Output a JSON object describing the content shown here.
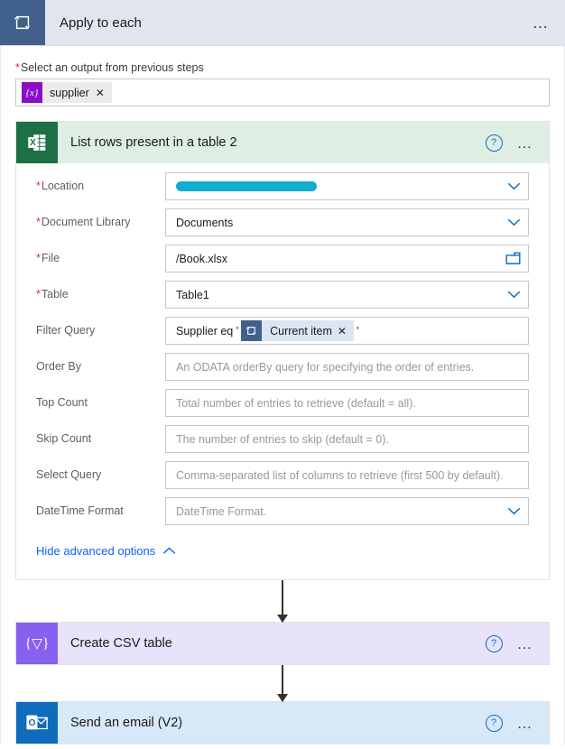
{
  "scope": {
    "title": "Apply to each",
    "icon": "loop-icon",
    "menu_label": "…",
    "input_label": "Select an output from previous steps",
    "required_marker": "*",
    "token": {
      "icon_glyph": "{x}",
      "label": "supplier",
      "remove_label": "✕"
    }
  },
  "excel_card": {
    "title": "List rows present in a table 2",
    "icon": "excel-icon",
    "help_label": "?",
    "menu_label": "…",
    "header_color": "#dfeee2",
    "icon_color": "#1d7044",
    "fields": [
      {
        "label": "Location",
        "required": true,
        "type": "dropdown",
        "value": "",
        "placeholder": "",
        "redacted": true
      },
      {
        "label": "Document Library",
        "required": true,
        "type": "dropdown",
        "value": "Documents",
        "placeholder": ""
      },
      {
        "label": "File",
        "required": true,
        "type": "filepicker",
        "value": "/Book.xlsx",
        "placeholder": ""
      },
      {
        "label": "Table",
        "required": true,
        "type": "dropdown",
        "value": "Table1",
        "placeholder": ""
      },
      {
        "label": "Filter Query",
        "required": false,
        "type": "tokenized",
        "prefix": "Supplier eq '",
        "suffix": "'",
        "token": {
          "icon_glyph": "loop-icon",
          "label": "Current item",
          "remove_label": "✕"
        }
      },
      {
        "label": "Order By",
        "required": false,
        "type": "text",
        "value": "",
        "placeholder": "An ODATA orderBy query for specifying the order of entries."
      },
      {
        "label": "Top Count",
        "required": false,
        "type": "text",
        "value": "",
        "placeholder": "Total number of entries to retrieve (default = all)."
      },
      {
        "label": "Skip Count",
        "required": false,
        "type": "text",
        "value": "",
        "placeholder": "The number of entries to skip (default = 0)."
      },
      {
        "label": "Select Query",
        "required": false,
        "type": "text",
        "value": "",
        "placeholder": "Comma-separated list of columns to retrieve (first 500 by default)."
      },
      {
        "label": "DateTime Format",
        "required": false,
        "type": "dropdown",
        "value": "",
        "placeholder": "DateTime Format."
      }
    ],
    "advanced_link": "Hide advanced options",
    "advanced_chevron": "⌃"
  },
  "csv_card": {
    "title": "Create CSV table",
    "icon": "data-operation-icon",
    "icon_glyph": "{∇}",
    "help_label": "?",
    "menu_label": "…",
    "header_color": "#e9e2fb",
    "icon_color": "#8661ef"
  },
  "email_card": {
    "title": "Send an email (V2)",
    "icon": "outlook-icon",
    "help_label": "?",
    "menu_label": "…",
    "header_color": "#d7e8f8",
    "icon_color": "#0f6cbd"
  }
}
